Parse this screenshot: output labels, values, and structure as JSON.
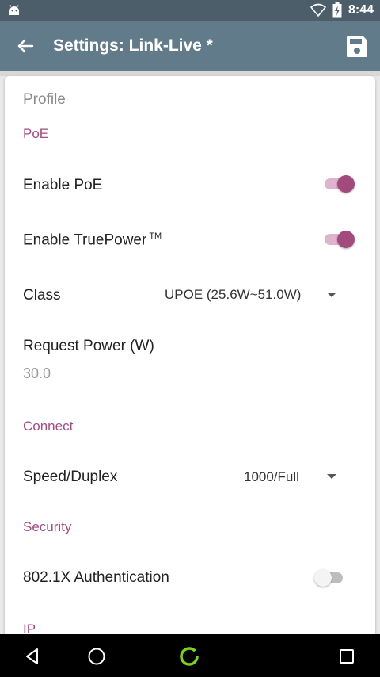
{
  "status_bar": {
    "time": "8:44"
  },
  "app_bar": {
    "title": "Settings: Link-Live *"
  },
  "card": {
    "heading": "Profile",
    "poe": {
      "header": "PoE",
      "enable_poe": {
        "label": "Enable PoE",
        "checked": true
      },
      "enable_truepower": {
        "label": "Enable TruePower",
        "tm": "TM",
        "checked": true
      },
      "class": {
        "label": "Class",
        "value": "UPOE (25.6W~51.0W)"
      },
      "request_power": {
        "label": "Request Power (W)",
        "value": "30.0"
      }
    },
    "connect": {
      "header": "Connect",
      "speed_duplex": {
        "label": "Speed/Duplex",
        "value": "1000/Full"
      }
    },
    "security": {
      "header": "Security",
      "auth_8021x": {
        "label": "802.1X Authentication",
        "checked": false
      }
    },
    "ip": {
      "header": "IP"
    }
  },
  "colors": {
    "status_bar": "#4d5e6b",
    "app_bar": "#617b8b",
    "accent": "#a24a7e",
    "section_header": "#a04c7f",
    "nav_bar": "#000000",
    "home_button": "#7ed321"
  },
  "icons": {
    "status_left": "android-icon",
    "wifi": "wifi-icon",
    "battery": "battery-charging-icon",
    "back": "arrow-back-icon",
    "save": "save-icon",
    "nav_back": "triangle-back-icon",
    "nav_home": "circle-home-icon",
    "nav_app": "green-ring-icon",
    "nav_recents": "square-recents-icon"
  }
}
